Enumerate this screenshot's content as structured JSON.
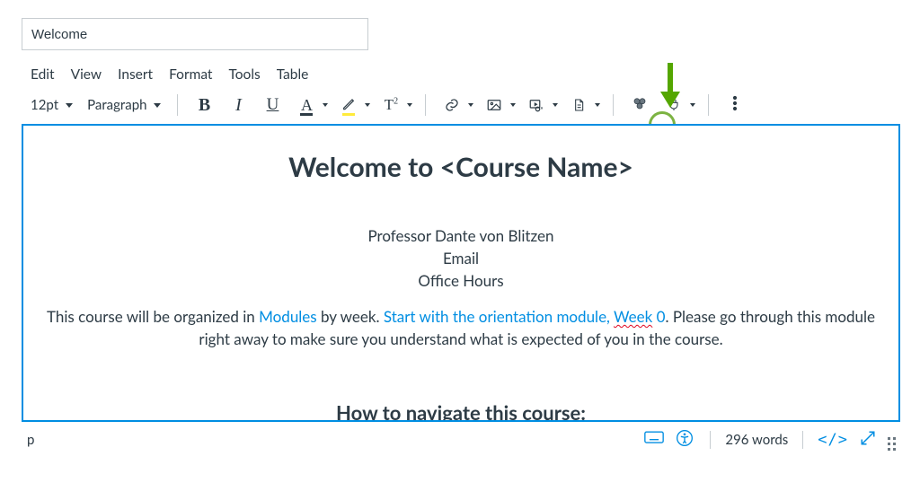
{
  "title_value": "Welcome",
  "menus": {
    "edit": "Edit",
    "view": "View",
    "insert": "Insert",
    "format": "Format",
    "tools": "Tools",
    "table": "Table"
  },
  "toolbar": {
    "font_size": "12pt",
    "paragraph": "Paragraph",
    "bold": "B",
    "italic": "I",
    "underline": "U",
    "text_A": "A",
    "super_T": "T",
    "super_exp": "2"
  },
  "content": {
    "heading": "Welcome to <Course Name>",
    "line1": "Professor Dante von Blitzen",
    "line2": "Email",
    "line3": "Office Hours",
    "para_a": "This course will be organized in ",
    "para_link1": "Modules",
    "para_b": " by week. ",
    "para_link2_a": "Start with the orientation module, ",
    "para_link2_spell": "Week",
    "para_link2_c": " 0",
    "para_c": ". Please go through this module right away to make sure you understand what is expected of you in the course.",
    "heading2": "How to navigate this course:"
  },
  "status": {
    "element_path": "p",
    "word_count": "296 words",
    "code_view": "</>"
  }
}
